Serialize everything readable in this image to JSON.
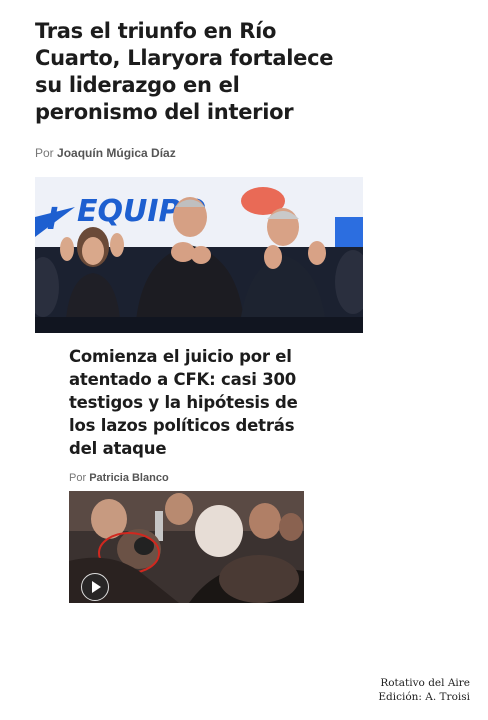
{
  "article1": {
    "headline": "Tras el triunfo en Río Cuarto, Llaryora fortalece su liderazgo en el peronismo del interior",
    "byline_prefix": "Por",
    "author": "Joaquín Múgica Díaz",
    "image_banner_text": "EQUIPO"
  },
  "article2": {
    "headline": "Comienza el juicio por el atentado a CFK: casi 300 testigos y la hipótesis de los lazos políticos detrás del ataque",
    "byline_prefix": "Por",
    "author": "Patricia Blanco",
    "video_icon": "play-icon"
  },
  "credits": {
    "line1": "Rotativo del Aire",
    "line2": "Edición: A. Troisi"
  },
  "colors": {
    "banner_blue": "#1d5fd0",
    "banner_red": "#e23b2e",
    "highlight_circle": "#d0281f"
  }
}
